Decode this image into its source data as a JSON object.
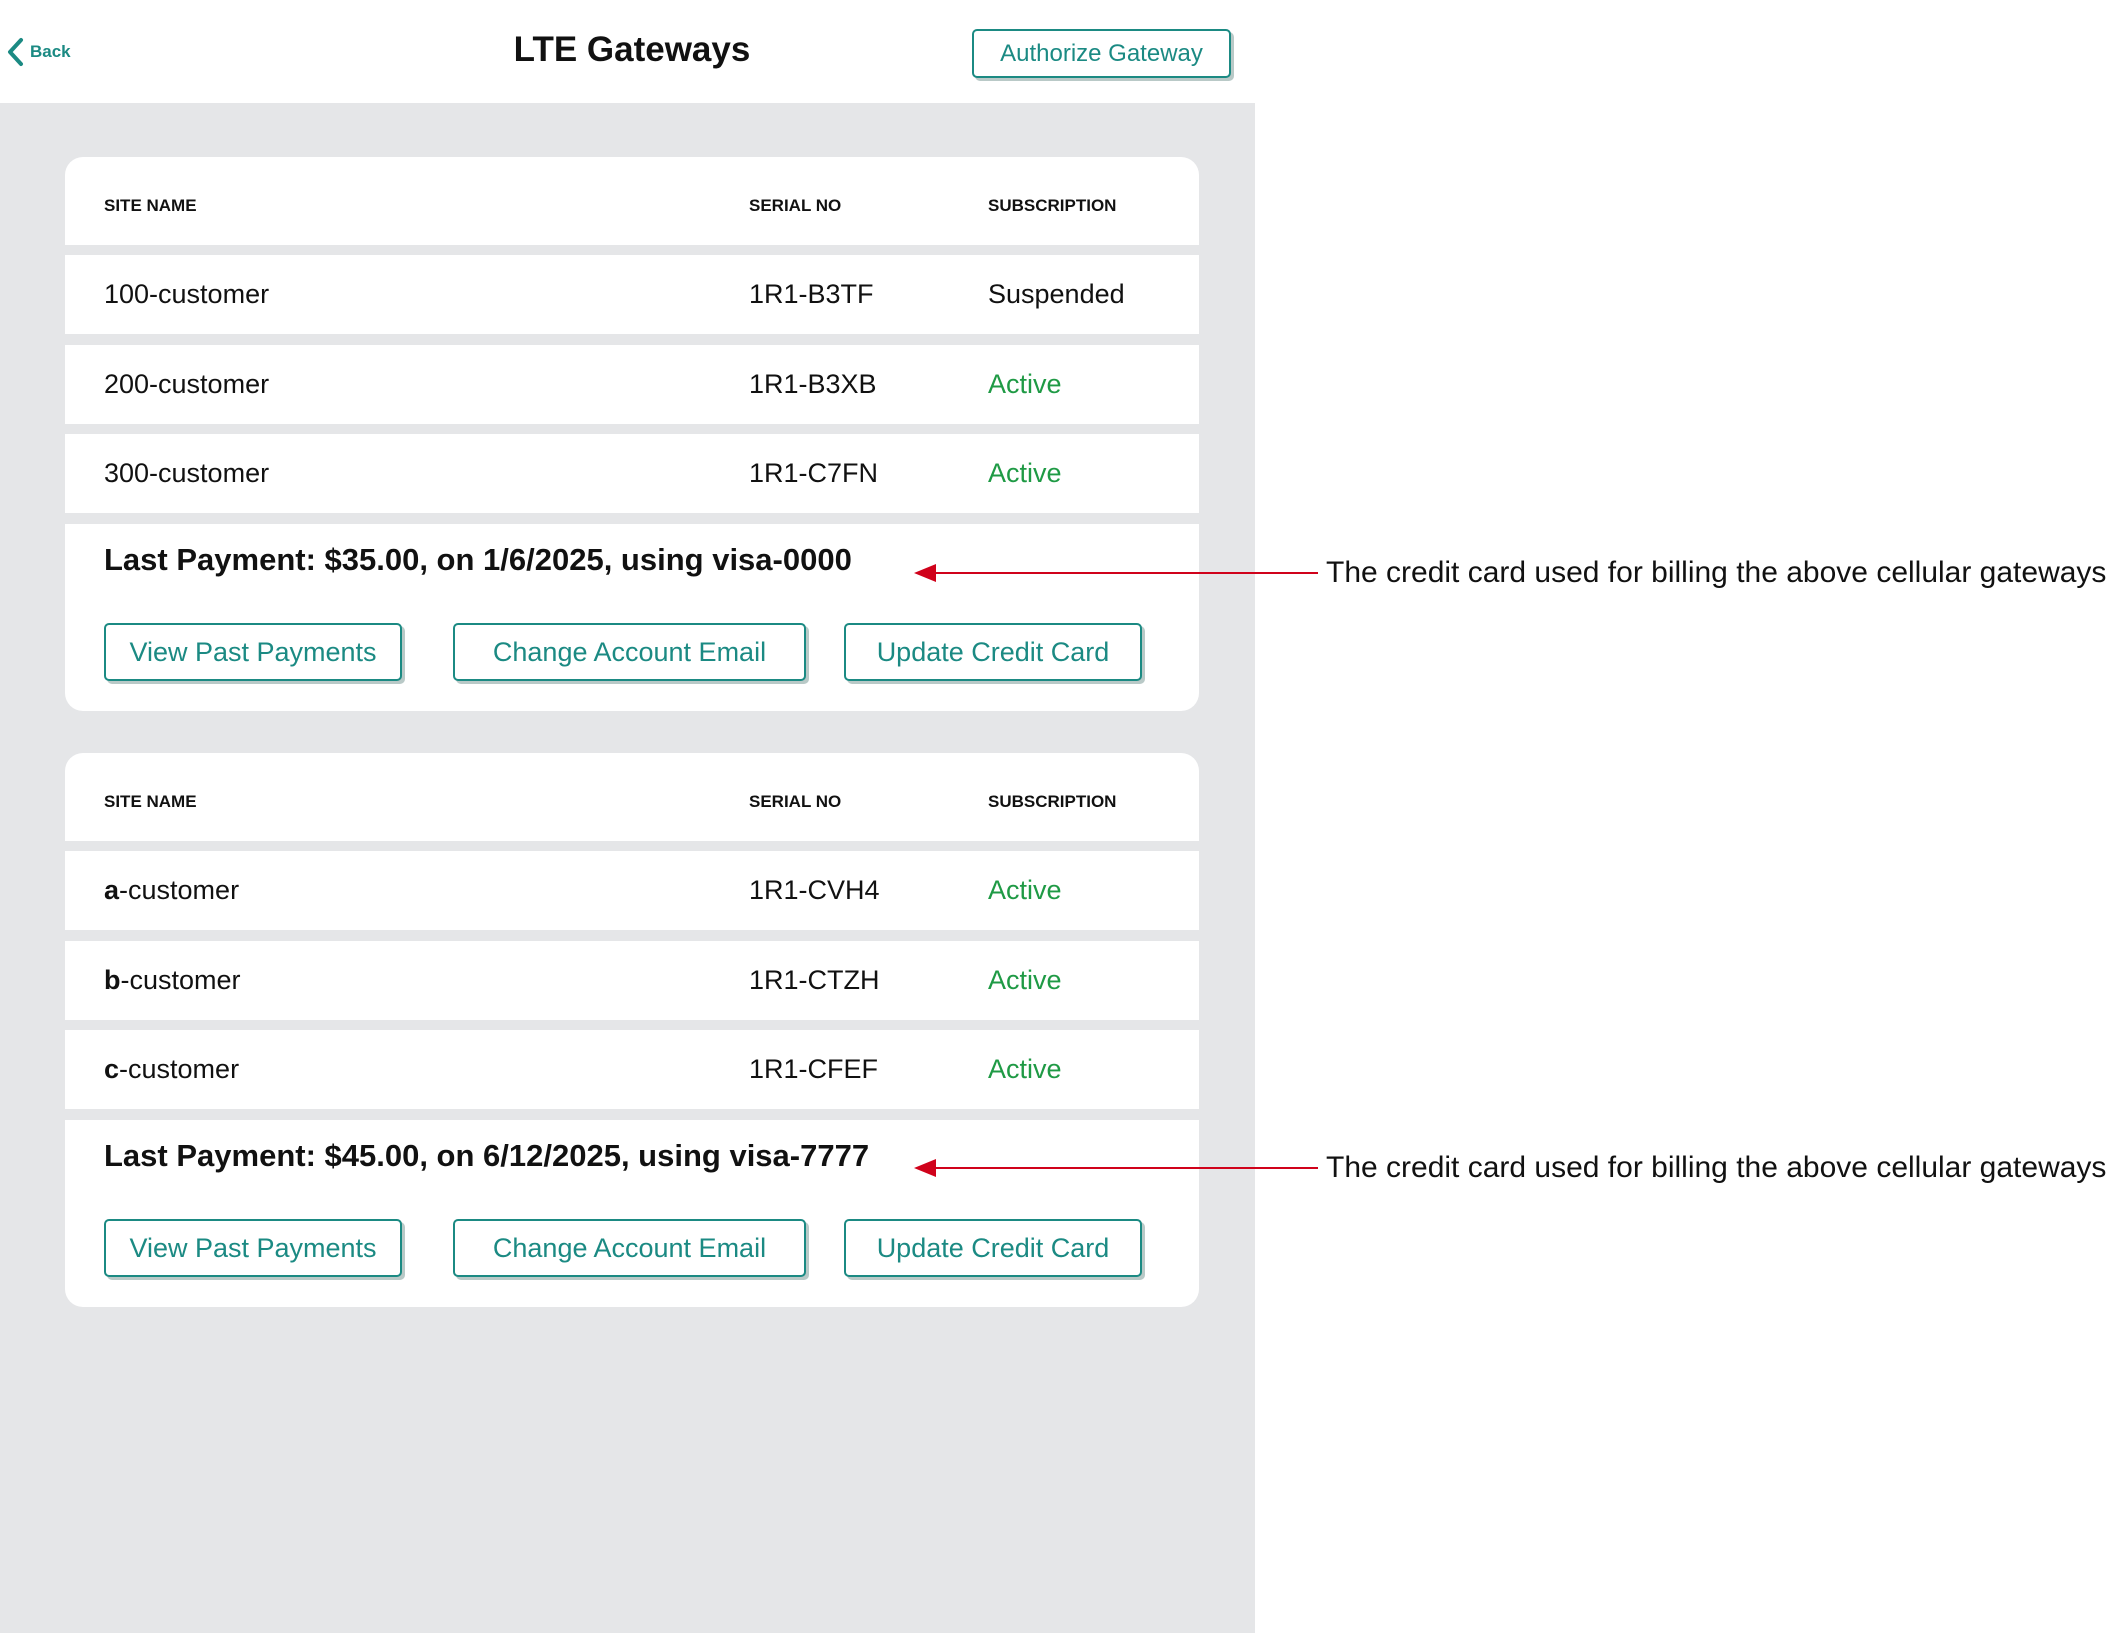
{
  "header": {
    "back_label": "Back",
    "title": "LTE Gateways",
    "authorize_label": "Authorize Gateway"
  },
  "columns": {
    "site": "SITE NAME",
    "serial": "SERIAL NO",
    "subscription": "SUBSCRIPTION"
  },
  "colors": {
    "accent": "#1b8a83",
    "active": "#1f9a45",
    "arrow": "#d0021b",
    "background": "#e5e6e8"
  },
  "groups": [
    {
      "rows": [
        {
          "prefix": "",
          "site": "100-customer",
          "serial": "1R1-B3TF",
          "status": "Suspended",
          "state": "suspended"
        },
        {
          "prefix": "",
          "site": "200-customer",
          "serial": "1R1-B3XB",
          "status": "Active",
          "state": "active"
        },
        {
          "prefix": "",
          "site": "300-customer",
          "serial": "1R1-C7FN",
          "status": "Active",
          "state": "active"
        }
      ],
      "payment": "Last Payment: $35.00, on 1/6/2025, using visa-0000",
      "buttons": {
        "past": "View Past Payments",
        "email": "Change Account Email",
        "card": "Update Credit Card"
      }
    },
    {
      "rows": [
        {
          "prefix": "a",
          "site": "-customer",
          "serial": "1R1-CVH4",
          "status": "Active",
          "state": "active"
        },
        {
          "prefix": "b",
          "site": "-customer",
          "serial": "1R1-CTZH",
          "status": "Active",
          "state": "active"
        },
        {
          "prefix": "c",
          "site": "-customer",
          "serial": "1R1-CFEF",
          "status": "Active",
          "state": "active"
        }
      ],
      "payment": "Last Payment: $45.00, on 6/12/2025, using visa-7777",
      "buttons": {
        "past": "View Past Payments",
        "email": "Change Account Email",
        "card": "Update Credit Card"
      }
    }
  ],
  "annotations": [
    "The credit card used for billing the above cellular gateways.",
    "The credit card used for billing the above cellular gateways."
  ]
}
